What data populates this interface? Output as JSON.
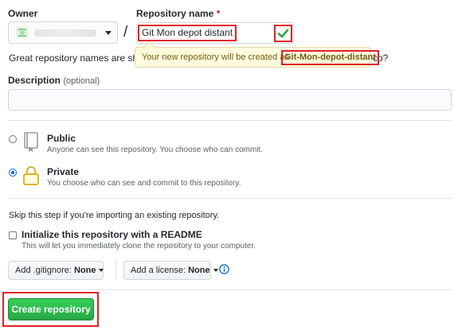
{
  "owner": {
    "label": "Owner"
  },
  "repo": {
    "label": "Repository name",
    "required_mark": "*",
    "value": "Git Mon depot distant",
    "separator": "/"
  },
  "hint": {
    "text_start": "Great repository names are shor",
    "text_end": "co?"
  },
  "tooltip": {
    "text": "Your new repository will be created as",
    "name": "Git-Mon-depot-distant"
  },
  "description": {
    "label": "Description",
    "optional": "(optional)",
    "value": ""
  },
  "visibility": {
    "public": {
      "title": "Public",
      "desc": "Anyone can see this repository. You choose who can commit."
    },
    "private": {
      "title": "Private",
      "desc": "You choose who can see and commit to this repository."
    },
    "selected": "private"
  },
  "import_hint": "Skip this step if you're importing an existing repository.",
  "readme": {
    "label": "Initialize this repository with a README",
    "desc": "This will let you immediately clone the repository to your computer.",
    "checked": false
  },
  "gitignore": {
    "label": "Add .gitignore:",
    "value": "None"
  },
  "license": {
    "label": "Add a license:",
    "value": "None"
  },
  "create_button": "Create repository",
  "colors": {
    "accent": "#0366d6",
    "success": "#28a745",
    "highlight": "#e0202a",
    "tooltip_bg": "#fffbdd"
  }
}
